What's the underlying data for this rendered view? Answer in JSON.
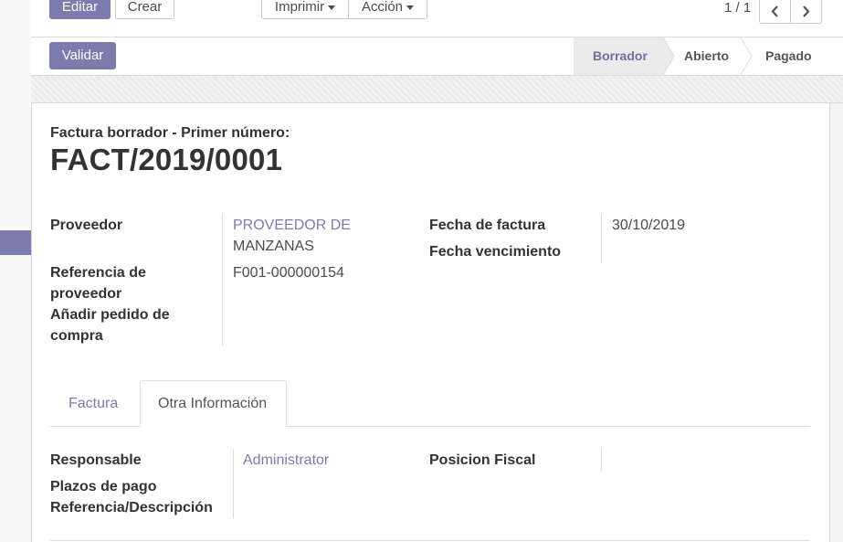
{
  "toolbar": {
    "edit_label": "Editar",
    "create_label": "Crear",
    "print_label": "Imprimir",
    "action_label": "Acción"
  },
  "pager": {
    "value": "1 / 1",
    "prev_icon": "chevron-left-icon",
    "next_icon": "chevron-right-icon"
  },
  "statusbar": {
    "validate_label": "Validar",
    "stages": [
      "Borrador",
      "Abierto",
      "Pagado"
    ],
    "active_stage": "Borrador"
  },
  "invoice": {
    "subtitle": "Factura borrador - Primer número:",
    "number": "FACT/2019/0001"
  },
  "fields_left": {
    "vendor_label": "Proveedor",
    "vendor_value_line1": "PROVEEDOR DE",
    "vendor_value_line2": "MANZANAS",
    "ref_label_line1": "Referencia de",
    "ref_label_line2": "proveedor",
    "ref_value": "F001-000000154",
    "po_label_line1": "Añadir pedido de",
    "po_label_line2": "compra"
  },
  "fields_right": {
    "invoice_date_label": "Fecha de factura",
    "invoice_date_value": "30/10/2019",
    "due_date_label": "Fecha vencimiento"
  },
  "tabs": {
    "items": [
      "Factura",
      "Otra Información"
    ],
    "active": "Otra Información"
  },
  "other_info": {
    "responsible_label": "Responsable",
    "responsible_value": "Administrator",
    "payment_terms_label": "Plazos de pago",
    "reference_label": "Referencia/Descripción",
    "fiscal_position_label": "Posicion Fiscal"
  },
  "colors": {
    "accent": "#7c7bad",
    "active_stage_bg": "#ebebeb"
  }
}
